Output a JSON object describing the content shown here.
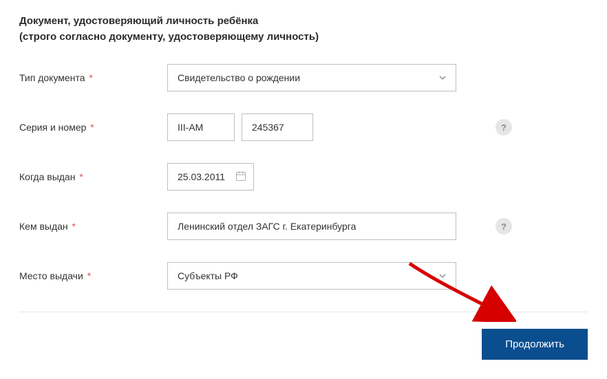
{
  "section": {
    "title_line1": "Документ, удостоверяющий личность ребёнка",
    "title_line2": "(строго согласно документу, удостоверяющему личность)"
  },
  "fields": {
    "doc_type": {
      "label": "Тип документа",
      "value": "Свидетельство о рождении"
    },
    "series_number": {
      "label": "Серия и номер",
      "series": "III-АМ",
      "number": "245367"
    },
    "issue_date": {
      "label": "Когда выдан",
      "value": "25.03.2011"
    },
    "issued_by": {
      "label": "Кем выдан",
      "value": "Ленинский отдел ЗАГС г. Екатеринбурга"
    },
    "issue_place": {
      "label": "Место выдачи",
      "value": "Субъекты РФ"
    }
  },
  "help_badge_text": "?",
  "required_mark": "*",
  "actions": {
    "continue": "Продолжить"
  }
}
